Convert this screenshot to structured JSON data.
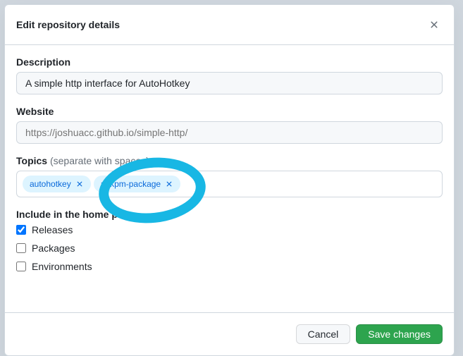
{
  "modal": {
    "title": "Edit repository details"
  },
  "description": {
    "label": "Description",
    "value": "A simple http interface for AutoHotkey"
  },
  "website": {
    "label": "Website",
    "placeholder": "https://joshuacc.github.io/simple-http/"
  },
  "topics": {
    "label": "Topics",
    "hint": "(separate with spaces)",
    "items": [
      {
        "name": "autohotkey"
      },
      {
        "name": "ahkpm-package"
      }
    ]
  },
  "include": {
    "label": "Include in the home page",
    "options": [
      {
        "name": "releases",
        "label": "Releases",
        "checked": true
      },
      {
        "name": "packages",
        "label": "Packages",
        "checked": false
      },
      {
        "name": "environments",
        "label": "Environments",
        "checked": false
      }
    ]
  },
  "buttons": {
    "cancel": "Cancel",
    "save": "Save changes"
  }
}
